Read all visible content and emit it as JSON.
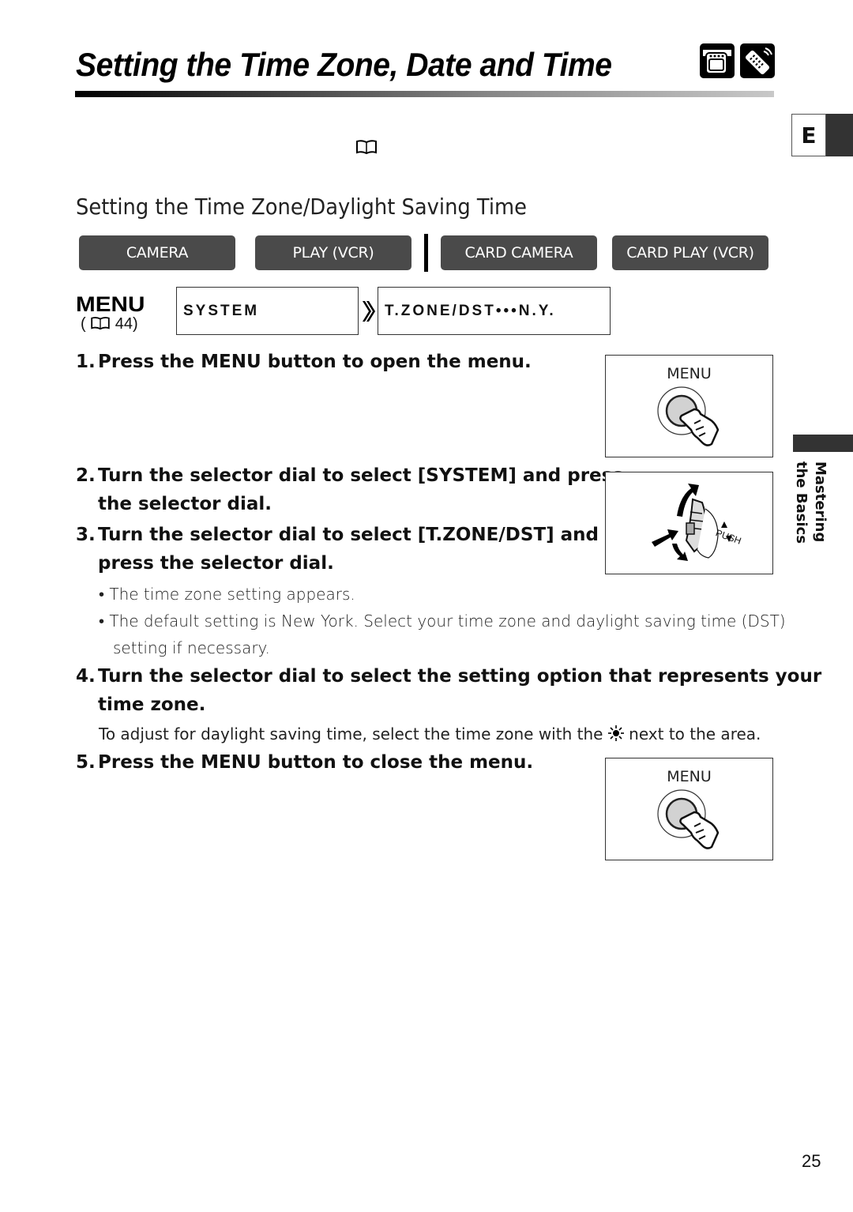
{
  "header": {
    "title": "Setting the Time Zone, Date and Time",
    "mode_icons": [
      "camcorder-icon",
      "remote-control-icon"
    ]
  },
  "reference_icon": "book-icon",
  "language_tab": {
    "letter": "E"
  },
  "section": {
    "title": "Setting the Time Zone/Daylight Saving Time"
  },
  "modes": [
    {
      "label": "CAMERA"
    },
    {
      "label": "PLAY (VCR)"
    },
    {
      "label": "CARD CAMERA"
    },
    {
      "label": "CARD PLAY (VCR)"
    }
  ],
  "menu_path": {
    "menu_label": "MENU",
    "page_ref_prefix": "(",
    "page_ref_page": "44)",
    "level1": "SYSTEM",
    "level2": "T.ZONE/DST•••N.Y."
  },
  "steps": [
    {
      "number": "1.",
      "text": "Press the MENU button to open the menu."
    },
    {
      "number": "2.",
      "line1": "Turn the selector dial to select [SYSTEM] and press",
      "line2": "the selector dial."
    },
    {
      "number": "3.",
      "line1": "Turn the selector dial to select [T.ZONE/DST] and",
      "line2": "press the selector dial."
    },
    {
      "number": "4.",
      "line1": "Turn the selector dial to select the setting option that represents your",
      "line2": "time zone."
    },
    {
      "number": "5.",
      "text": "Press the MENU button to close the menu."
    }
  ],
  "bullets": [
    {
      "text": "• The time zone setting appears."
    },
    {
      "line1": "• The default setting is New York. Select your time zone and daylight saving time (DST)",
      "line2": "setting if necessary."
    }
  ],
  "note": {
    "before": "To adjust for daylight saving time, select the time zone with the ",
    "icon": "sun-icon",
    "after": " next to the area."
  },
  "figures": {
    "menu_button_label": "MENU",
    "dial_push_label": "PUSH"
  },
  "side_tab": {
    "line1": "Mastering",
    "line2": "the Basics"
  },
  "page_number": "25"
}
